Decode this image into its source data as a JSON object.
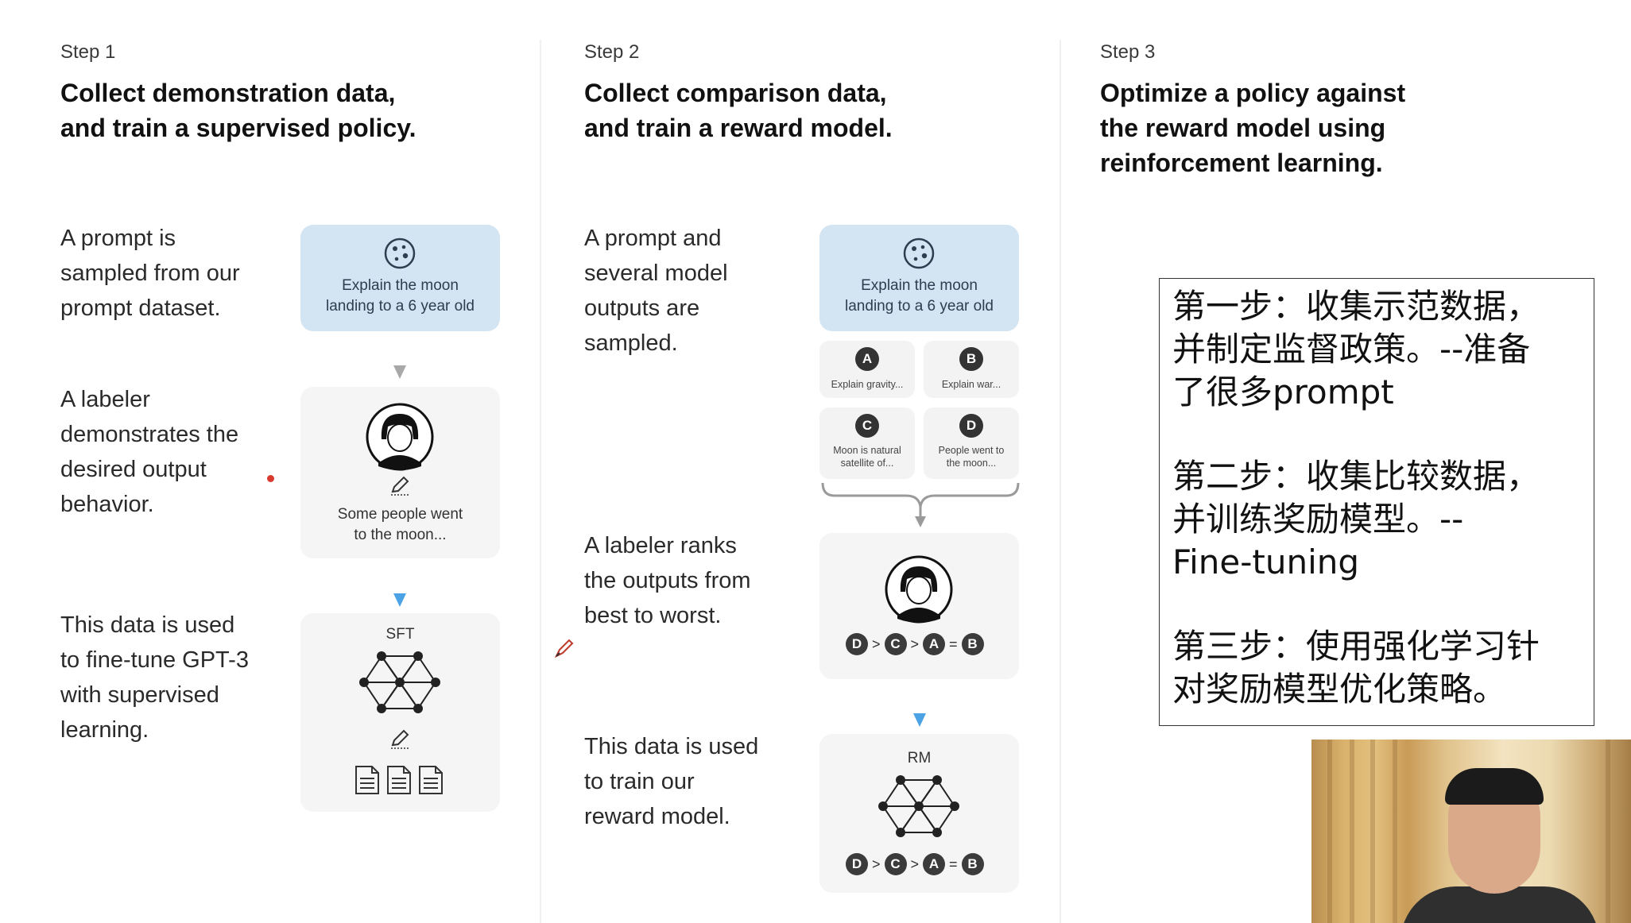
{
  "step1": {
    "label": "Step 1",
    "title": "Collect demonstration data,\nand train a supervised policy.",
    "descs": [
      "A prompt is\nsampled from our\nprompt dataset.",
      "A labeler\ndemonstrates the\ndesired output\nbehavior.",
      "This data is used\nto fine-tune GPT-3\nwith supervised\nlearning."
    ],
    "prompt_card": "Explain the moon\nlanding to a 6 year old",
    "labeler_card": "Some people went\nto the moon...",
    "model_label": "SFT"
  },
  "step2": {
    "label": "Step 2",
    "title": "Collect comparison data,\nand train a reward model.",
    "descs": [
      "A prompt and\nseveral model\noutputs are\nsampled.",
      "A labeler ranks\nthe outputs from\nbest to worst.",
      "This data is used\nto train our\nreward model."
    ],
    "prompt_card": "Explain the moon\nlanding to a 6 year old",
    "outputs": [
      {
        "letter": "A",
        "text": "Explain gravity..."
      },
      {
        "letter": "B",
        "text": "Explain war..."
      },
      {
        "letter": "C",
        "text": "Moon is natural\nsatellite of..."
      },
      {
        "letter": "D",
        "text": "People went to\nthe moon..."
      }
    ],
    "ranking": [
      "D",
      ">",
      "C",
      ">",
      "A",
      "=",
      "B"
    ],
    "model_label": "RM"
  },
  "step3": {
    "label": "Step 3",
    "title": "Optimize a policy against\nthe reward model using\nreinforcement learning."
  },
  "notes": {
    "line1": "第一步：收集示范数据，\n并制定监督政策。--准备\n了很多prompt",
    "line2": "第二步：收集比较数据，\n并训练奖励模型。--\nFine-tuning",
    "line3": "第三步：使用强化学习针\n对奖励模型优化策略。"
  },
  "icons": [
    "moon-icon",
    "labeler-avatar-icon",
    "pencil-icon",
    "neural-network-icon",
    "document-icon",
    "pen-cursor-icon"
  ],
  "colors": {
    "prompt_card": "#d3e4f2",
    "card": "#f5f5f5",
    "blue_arrow": "#4ba3e6",
    "gray_arrow": "#a8a8a8"
  }
}
